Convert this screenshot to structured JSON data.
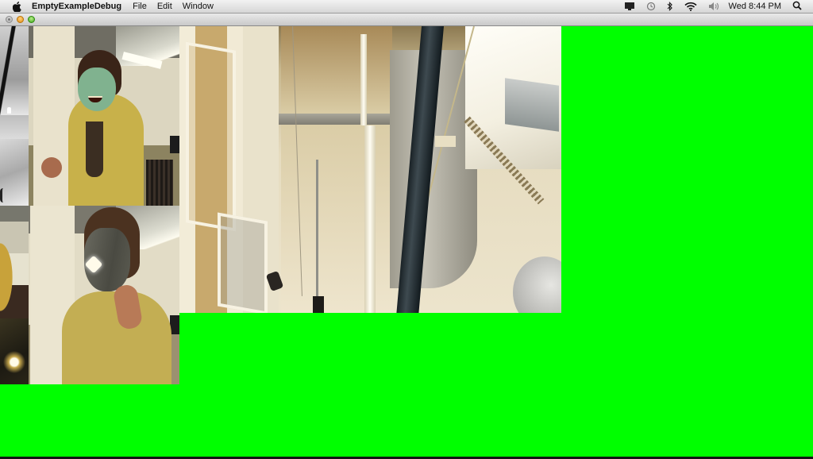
{
  "menubar": {
    "apple_icon": "apple-logo-icon",
    "app_name": "EmptyExampleDebug",
    "menus": [
      "File",
      "Edit",
      "Window"
    ],
    "status_icons": [
      "display-mirroring-icon",
      "time-machine-icon",
      "bluetooth-icon",
      "wifi-icon",
      "volume-icon"
    ],
    "clock": "Wed 8:44 PM",
    "spotlight_icon": "spotlight-search-icon"
  },
  "window": {
    "title": "",
    "buttons": [
      "close",
      "minimize",
      "zoom"
    ],
    "background_color": "#00ff00"
  },
  "canvas": {
    "frames": [
      {
        "id": "grayscale-tile-1",
        "description": "grayscale depth/IR camera tile"
      },
      {
        "id": "grayscale-tile-2",
        "description": "grayscale depth/IR camera tile"
      },
      {
        "id": "color-tile-1",
        "description": "small color camera tile of office"
      },
      {
        "id": "color-tile-2",
        "description": "small color camera tile with light glare"
      },
      {
        "id": "face-frame-1",
        "description": "webcam frame of person with green face mask overlay"
      },
      {
        "id": "face-frame-2",
        "description": "webcam frame of person with grey textured face mask overlay"
      },
      {
        "id": "scene-frame",
        "description": "camera view of atrium with pipes, pole and windows"
      }
    ]
  }
}
